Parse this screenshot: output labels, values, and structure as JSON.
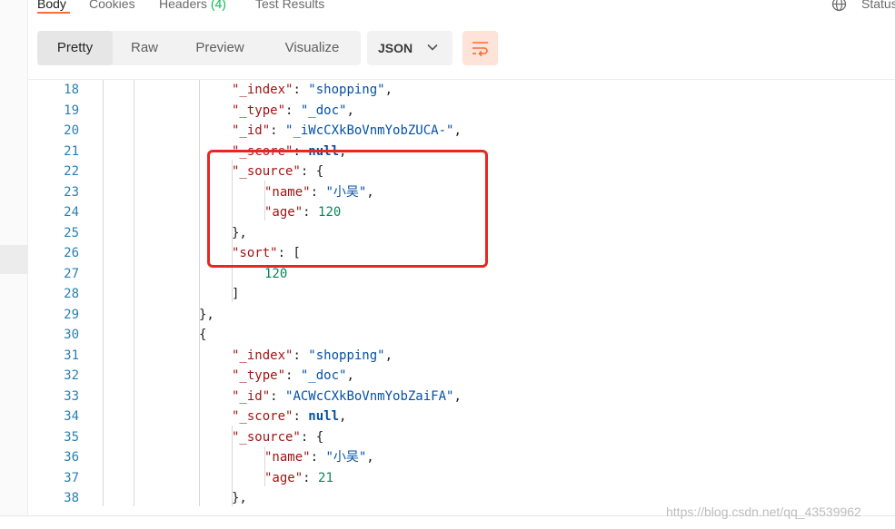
{
  "tabs": {
    "body": "Body",
    "cookies": "Cookies",
    "headers_label": "Headers",
    "headers_count": "(4)",
    "test_results": "Test Results",
    "status": "Status"
  },
  "toolbar": {
    "view_modes": [
      "Pretty",
      "Raw",
      "Preview",
      "Visualize"
    ],
    "active_view": "Pretty",
    "format": "JSON",
    "wrap_icon": "wrap-lines-icon"
  },
  "editor": {
    "lines": [
      {
        "n": "18",
        "t": [
          [
            "k",
            "\"_index\""
          ],
          [
            "p",
            ": "
          ],
          [
            "s",
            "\"shopping\""
          ],
          [
            "p",
            ","
          ]
        ]
      },
      {
        "n": "19",
        "t": [
          [
            "k",
            "\"_type\""
          ],
          [
            "p",
            ": "
          ],
          [
            "s",
            "\"_doc\""
          ],
          [
            "p",
            ","
          ]
        ]
      },
      {
        "n": "20",
        "t": [
          [
            "k",
            "\"_id\""
          ],
          [
            "p",
            ": "
          ],
          [
            "s",
            "\"_iWcCXkBoVnmYobZUCA-\""
          ],
          [
            "p",
            ","
          ]
        ]
      },
      {
        "n": "21",
        "t": [
          [
            "k",
            "\"_score\""
          ],
          [
            "p",
            ": "
          ],
          [
            "kw",
            "null"
          ],
          [
            "p",
            ","
          ]
        ]
      },
      {
        "n": "22",
        "t": [
          [
            "k",
            "\"_source\""
          ],
          [
            "p",
            ": {"
          ]
        ]
      },
      {
        "n": "23",
        "t": [
          [
            "k",
            "\"name\""
          ],
          [
            "p",
            ": "
          ],
          [
            "s",
            "\"小吴\""
          ],
          [
            "p",
            ","
          ]
        ]
      },
      {
        "n": "24",
        "t": [
          [
            "k",
            "\"age\""
          ],
          [
            "p",
            ": "
          ],
          [
            "n",
            "120"
          ]
        ]
      },
      {
        "n": "25",
        "t": [
          [
            "p",
            "},"
          ]
        ]
      },
      {
        "n": "26",
        "t": [
          [
            "k",
            "\"sort\""
          ],
          [
            "p",
            ": ["
          ]
        ]
      },
      {
        "n": "27",
        "t": [
          [
            "n",
            "120"
          ]
        ]
      },
      {
        "n": "28",
        "t": [
          [
            "p",
            "]"
          ]
        ]
      },
      {
        "n": "29",
        "t": [
          [
            "p",
            "},"
          ]
        ]
      },
      {
        "n": "30",
        "t": [
          [
            "p",
            "{"
          ]
        ]
      },
      {
        "n": "31",
        "t": [
          [
            "k",
            "\"_index\""
          ],
          [
            "p",
            ": "
          ],
          [
            "s",
            "\"shopping\""
          ],
          [
            "p",
            ","
          ]
        ]
      },
      {
        "n": "32",
        "t": [
          [
            "k",
            "\"_type\""
          ],
          [
            "p",
            ": "
          ],
          [
            "s",
            "\"_doc\""
          ],
          [
            "p",
            ","
          ]
        ]
      },
      {
        "n": "33",
        "t": [
          [
            "k",
            "\"_id\""
          ],
          [
            "p",
            ": "
          ],
          [
            "s",
            "\"ACWcCXkBoVnmYobZaiFA\""
          ],
          [
            "p",
            ","
          ]
        ]
      },
      {
        "n": "34",
        "t": [
          [
            "k",
            "\"_score\""
          ],
          [
            "p",
            ": "
          ],
          [
            "kw",
            "null"
          ],
          [
            "p",
            ","
          ]
        ]
      },
      {
        "n": "35",
        "t": [
          [
            "k",
            "\"_source\""
          ],
          [
            "p",
            ": {"
          ]
        ]
      },
      {
        "n": "36",
        "t": [
          [
            "k",
            "\"name\""
          ],
          [
            "p",
            ": "
          ],
          [
            "s",
            "\"小吴\""
          ],
          [
            "p",
            ","
          ]
        ]
      },
      {
        "n": "37",
        "t": [
          [
            "k",
            "\"age\""
          ],
          [
            "p",
            ": "
          ],
          [
            "n",
            "21"
          ]
        ]
      },
      {
        "n": "38",
        "t": [
          [
            "p",
            "},"
          ]
        ]
      }
    ]
  },
  "watermark": "https://blog.csdn.net/qq_43539962",
  "colors": {
    "accent": "#ff6c37",
    "highlight": "#e8281f",
    "key": "#a31515",
    "string": "#0451a5",
    "number": "#098658",
    "line_number": "#2a7fb0"
  }
}
